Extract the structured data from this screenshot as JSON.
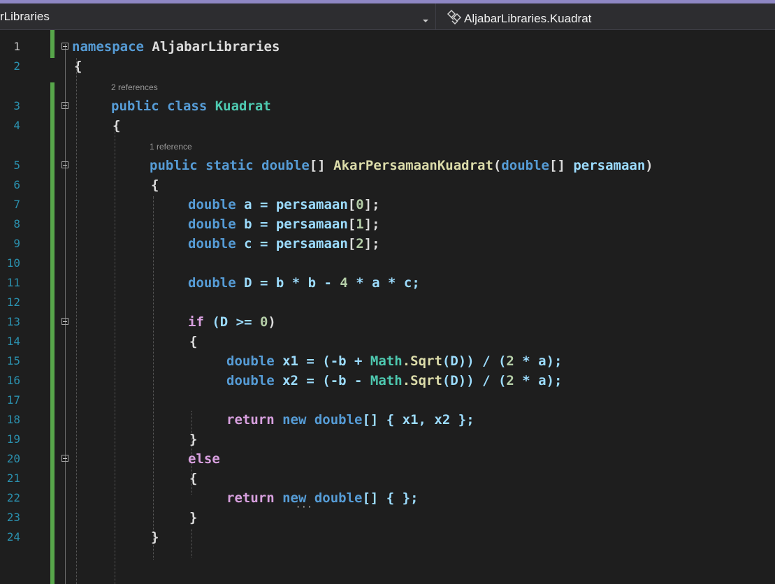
{
  "navbar": {
    "left_label": "rLibraries",
    "right_label": "AljabarLibraries.Kuadrat",
    "dropdown_icon": "chevron-down-icon",
    "class_icon": "class-icon"
  },
  "editor": {
    "line_numbers": [
      "1",
      "2",
      "3",
      "4",
      "5",
      "6",
      "7",
      "8",
      "9",
      "10",
      "11",
      "12",
      "13",
      "14",
      "15",
      "16",
      "17",
      "18",
      "19",
      "20",
      "21",
      "22",
      "23",
      "24"
    ],
    "codelens": {
      "class_refs": "2 references",
      "method_refs": "1 reference"
    },
    "lines": {
      "l1_kw": "namespace",
      "l1_name": " AljabarLibraries",
      "brace_open": "{",
      "brace_close": "}",
      "public": "public",
      "class": " class ",
      "class_name": "Kuadrat",
      "static": " static ",
      "double": "double",
      "arr": "[]",
      "method_name": " AkarPersamaanKuadrat",
      "paren_open": "(",
      "param_name": " persamaan",
      "paren_close": ")",
      "l7": [
        " a = ",
        "persamaan",
        "[",
        "0",
        "];"
      ],
      "l8": [
        " b = ",
        "persamaan",
        "[",
        "1",
        "];"
      ],
      "l9": [
        " c = ",
        "persamaan",
        "[",
        "2",
        "];"
      ],
      "l11_rest": " D = b * b - ",
      "l11_num": "4",
      "l11_tail": " * a * c;",
      "if": "if",
      "l13_rest": " (D >= ",
      "l13_num": "0",
      "l13_tail": ")",
      "l15_a": " x1 = (-b + ",
      "l16_a": " x2 = (-b - ",
      "math": "Math",
      "sqrt": ".Sqrt",
      "l15_b": "(D)) / (",
      "l15_num": "2",
      "l15_c": " * a);",
      "return": "return",
      "new": " new ",
      "l18_tail": "[] { x1, x2 };",
      "else": "else",
      "l22_tail": "[] { };"
    }
  }
}
